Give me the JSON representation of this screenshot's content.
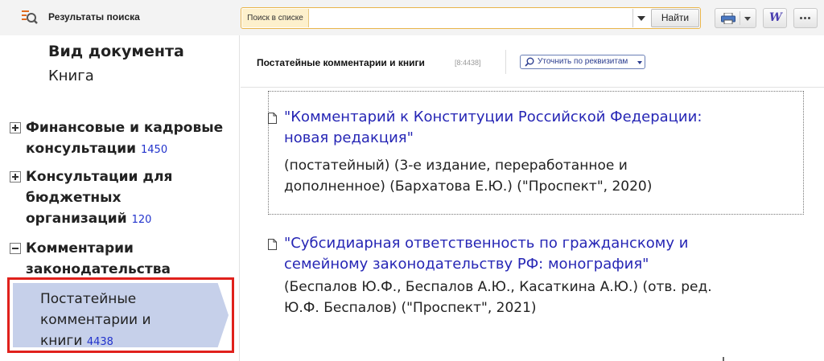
{
  "topbar": {
    "results_title": "Результаты поиска",
    "search_label": "Поиск в списке",
    "search_value": "",
    "find_button": "Найти",
    "icons": [
      "search-results-icon",
      "printer-icon",
      "word-export-icon",
      "more-dots-icon"
    ],
    "word_glyph": "W"
  },
  "left": {
    "doctype_title": "Вид документа",
    "doctype_value": "Книга",
    "tree": [
      {
        "line1": "Финансовые и кадровые",
        "line2": "консультации",
        "count": "1450",
        "expanded": false
      },
      {
        "line1": "Консультации для",
        "line2": "бюджетных",
        "line3": "организаций",
        "count": "120",
        "expanded": false
      },
      {
        "line1": "Комментарии",
        "line2": "законодательства",
        "expanded": true
      }
    ],
    "selected": {
      "line1": "Постатейные",
      "line2": "комментарии и",
      "line3": "книги",
      "count": "4438",
      "highlight_color": "#e0211c"
    }
  },
  "right": {
    "section_title": "Постатейные комментарии и книги",
    "section_count": "[8:4438]",
    "refine_button": "Уточнить по реквизитам",
    "documents": [
      {
        "title_line1": "\"Комментарий к Конституции Российской Федерации:",
        "title_line2": "новая редакция\"",
        "desc_line1": "(постатейный) (3-е издание, переработанное и",
        "desc_line2": "дополненное) (Бархатова Е.Ю.) (\"Проспект\", 2020)"
      },
      {
        "title_line1": "\"Субсидиарная ответственность по гражданскому и",
        "title_line2": "семейному законодательству РФ: монография\"",
        "desc_line1": "(Беспалов Ю.Ф., Беспалов А.Ю., Касаткина А.Ю.) (отв. ред.",
        "desc_line2": "Ю.Ф. Беспалов) (\"Проспект\", 2021)"
      }
    ]
  },
  "colors": {
    "link": "#2626b5",
    "selected_bg": "#c6d0ea",
    "search_border": "#e8b44a",
    "count": "#2233cc"
  }
}
